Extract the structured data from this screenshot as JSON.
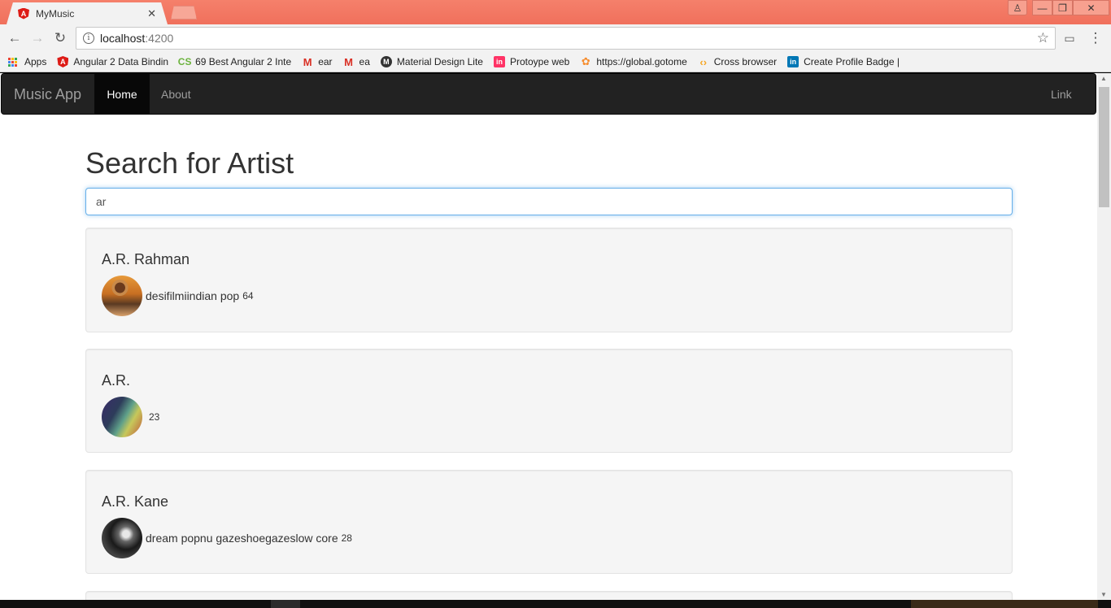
{
  "browser": {
    "tab_title": "MyMusic",
    "tab_close": "✕",
    "url_host": "localhost",
    "url_port": ":4200",
    "window_buttons": {
      "user": "♙",
      "minimize": "—",
      "maximize": "❐",
      "close": "✕"
    }
  },
  "bookmarks": [
    {
      "label": "Apps",
      "icon": "apps-grid-icon"
    },
    {
      "label": "Angular 2 Data Bindin",
      "icon": "angular-icon"
    },
    {
      "label": "69 Best Angular 2 Inte",
      "icon": "cs-icon"
    },
    {
      "label": "ear",
      "icon": "gmail-icon"
    },
    {
      "label": "ea",
      "icon": "gmail-icon"
    },
    {
      "label": "Material Design Lite",
      "icon": "material-icon"
    },
    {
      "label": "Protoype web",
      "icon": "invision-icon"
    },
    {
      "label": "https://global.gotome",
      "icon": "gotomeeting-icon"
    },
    {
      "label": "Cross browser",
      "icon": "crossbrowser-icon"
    },
    {
      "label": "Create Profile Badge |",
      "icon": "linkedin-icon"
    }
  ],
  "navbar": {
    "brand": "Music App",
    "items": [
      "Home",
      "About"
    ],
    "right_link": "Link"
  },
  "main": {
    "heading": "Search for Artist",
    "search_value": "ar"
  },
  "artists": [
    {
      "name": "A.R. Rahman",
      "genres": "desifilmiindian pop",
      "popularity": "64"
    },
    {
      "name": "A.R.",
      "genres": "",
      "popularity": "23"
    },
    {
      "name": "A.R. Kane",
      "genres": "dream popnu gazeshoegazeslow core",
      "popularity": "28"
    }
  ],
  "colors": {
    "titlebar": "#f0705c",
    "navbar": "#222222",
    "navbar_active": "#080808",
    "well": "#f5f5f5",
    "focus_border": "#66afe9"
  }
}
